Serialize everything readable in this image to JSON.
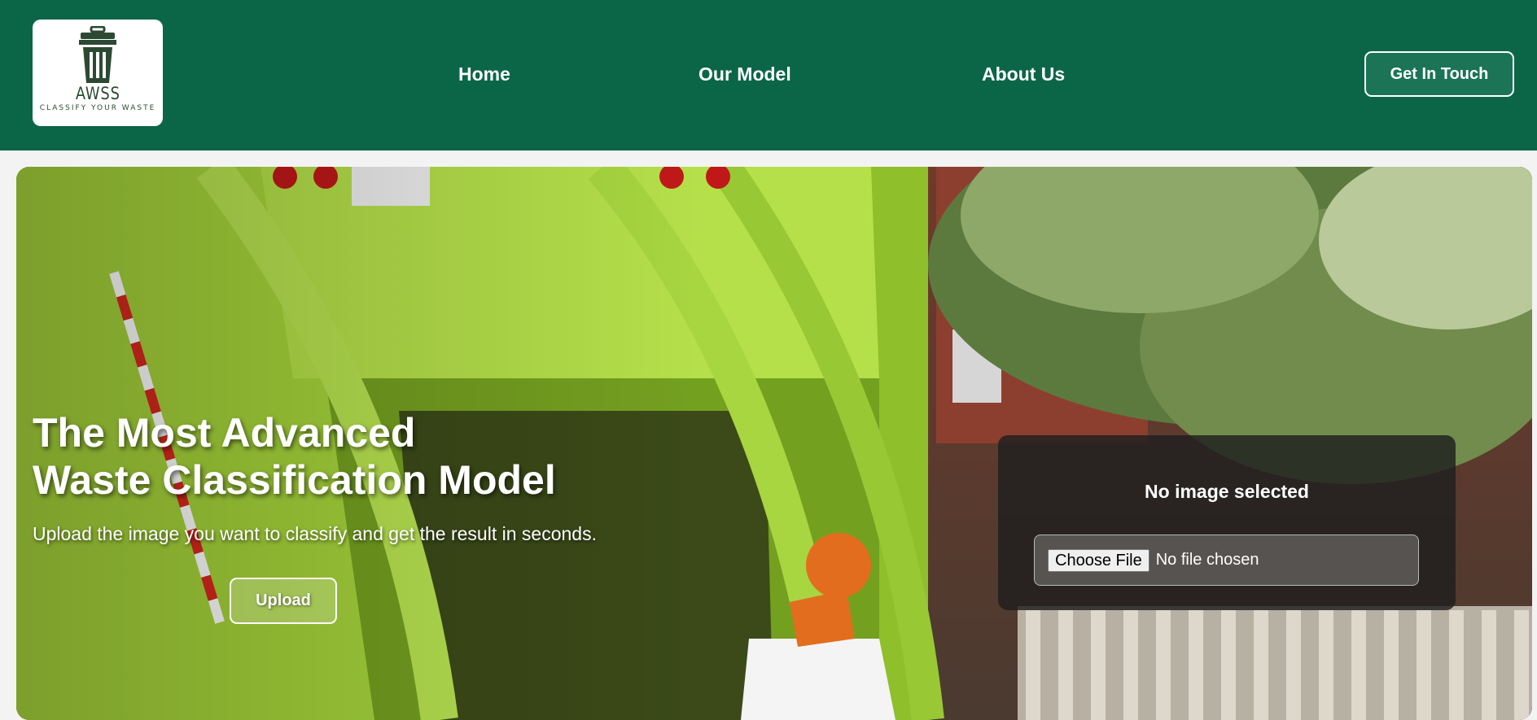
{
  "brand": {
    "name": "AWSS",
    "tagline": "CLASSIFY YOUR WASTE"
  },
  "nav": {
    "items": [
      {
        "label": "Home"
      },
      {
        "label": "Our Model"
      },
      {
        "label": "About Us"
      }
    ],
    "cta_label": "Get In Touch"
  },
  "hero": {
    "title_line1": "The Most Advanced",
    "title_line2": "Waste Classification Model",
    "subtitle": "Upload the image you want to classify and get the result in seconds.",
    "upload_label": "Upload",
    "background_icon": "garbage-truck-photo"
  },
  "upload_panel": {
    "status": "No image selected",
    "file_input": {
      "button_label": "Choose File",
      "status": "No file chosen"
    }
  },
  "colors": {
    "navbar": "#0b6647",
    "cta_bg": "#1b7455",
    "page_bg": "#f3f3f3"
  }
}
